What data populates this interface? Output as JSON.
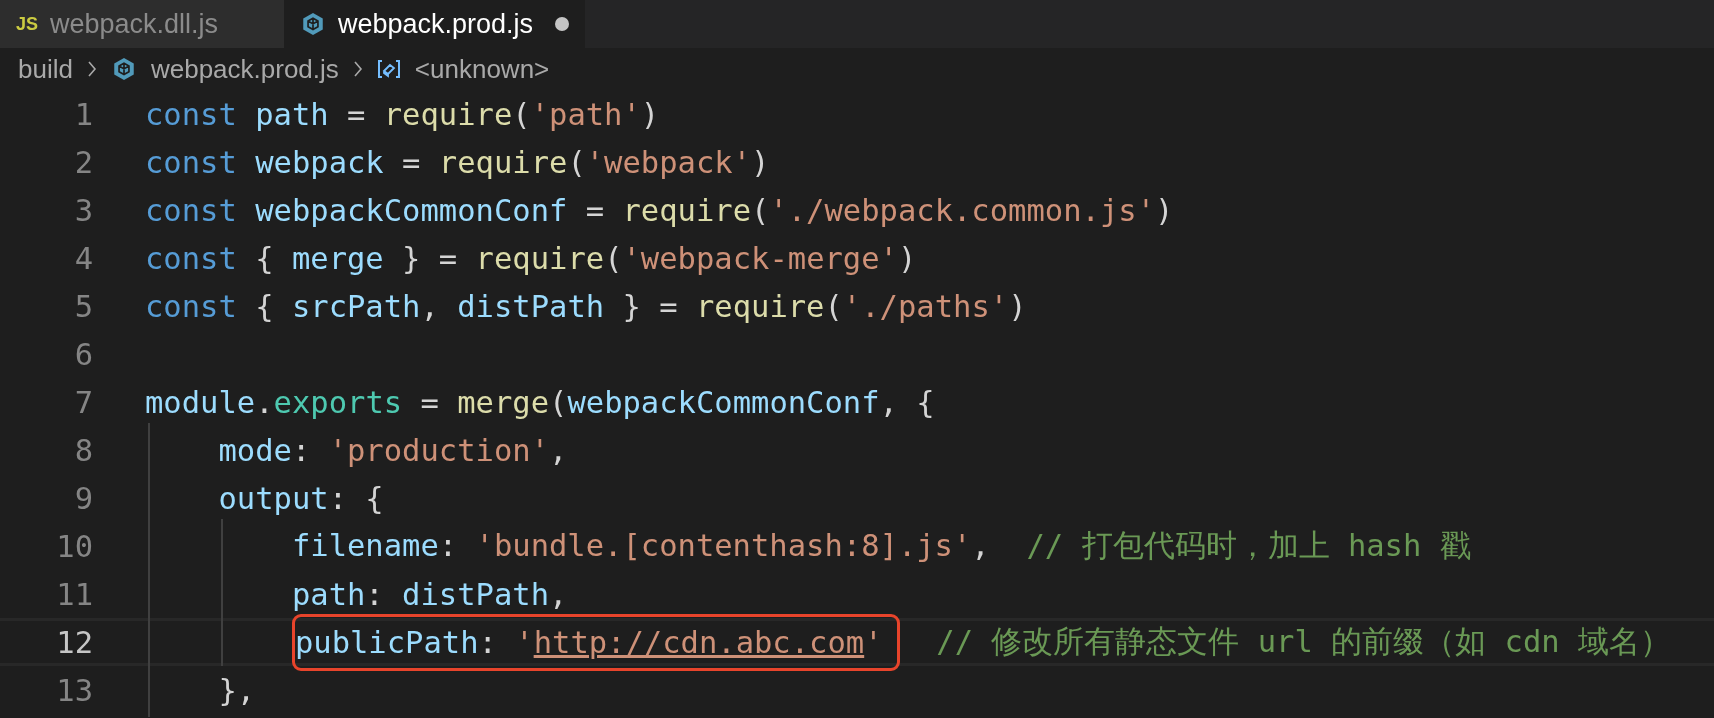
{
  "tabs": [
    {
      "kind": "js",
      "icon_text": "JS",
      "label": "webpack.dll.js",
      "selected": false,
      "modified": false
    },
    {
      "kind": "webpack",
      "label": "webpack.prod.js",
      "selected": true,
      "modified": true
    }
  ],
  "breadcrumb": [
    {
      "kind": "folder",
      "label": "build"
    },
    {
      "kind": "webpack",
      "label": "webpack.prod.js"
    },
    {
      "kind": "symbol",
      "label": "<unknown>"
    }
  ],
  "lines": [
    {
      "number": "1",
      "current": false,
      "segments": [
        {
          "highlighted": false,
          "tokens": [
            {
              "kind": "keyword",
              "text": "const"
            },
            {
              "kind": "variable",
              "text": " path"
            },
            {
              "kind": "plain",
              "text": " = "
            },
            {
              "kind": "function",
              "text": "require"
            },
            {
              "kind": "plain",
              "text": "("
            },
            {
              "kind": "string",
              "text": "'path'"
            },
            {
              "kind": "plain",
              "text": ")"
            }
          ]
        }
      ]
    },
    {
      "number": "2",
      "current": false,
      "segments": [
        {
          "highlighted": false,
          "tokens": [
            {
              "kind": "keyword",
              "text": "const"
            },
            {
              "kind": "variable",
              "text": " webpack"
            },
            {
              "kind": "plain",
              "text": " = "
            },
            {
              "kind": "function",
              "text": "require"
            },
            {
              "kind": "plain",
              "text": "("
            },
            {
              "kind": "string",
              "text": "'webpack'"
            },
            {
              "kind": "plain",
              "text": ")"
            }
          ]
        }
      ]
    },
    {
      "number": "3",
      "current": false,
      "segments": [
        {
          "highlighted": false,
          "tokens": [
            {
              "kind": "keyword",
              "text": "const"
            },
            {
              "kind": "variable",
              "text": " webpackCommonConf"
            },
            {
              "kind": "plain",
              "text": " = "
            },
            {
              "kind": "function",
              "text": "require"
            },
            {
              "kind": "plain",
              "text": "("
            },
            {
              "kind": "string",
              "text": "'./webpack.common.js'"
            },
            {
              "kind": "plain",
              "text": ")"
            }
          ]
        }
      ]
    },
    {
      "number": "4",
      "current": false,
      "segments": [
        {
          "highlighted": false,
          "tokens": [
            {
              "kind": "keyword",
              "text": "const"
            },
            {
              "kind": "plain",
              "text": " { "
            },
            {
              "kind": "variable",
              "text": "merge"
            },
            {
              "kind": "plain",
              "text": " } = "
            },
            {
              "kind": "function",
              "text": "require"
            },
            {
              "kind": "plain",
              "text": "("
            },
            {
              "kind": "string",
              "text": "'webpack-merge'"
            },
            {
              "kind": "plain",
              "text": ")"
            }
          ]
        }
      ]
    },
    {
      "number": "5",
      "current": false,
      "segments": [
        {
          "highlighted": false,
          "tokens": [
            {
              "kind": "keyword",
              "text": "const"
            },
            {
              "kind": "plain",
              "text": " { "
            },
            {
              "kind": "variable",
              "text": "srcPath"
            },
            {
              "kind": "plain",
              "text": ", "
            },
            {
              "kind": "variable",
              "text": "distPath"
            },
            {
              "kind": "plain",
              "text": " } = "
            },
            {
              "kind": "function",
              "text": "require"
            },
            {
              "kind": "plain",
              "text": "("
            },
            {
              "kind": "string",
              "text": "'./paths'"
            },
            {
              "kind": "plain",
              "text": ")"
            }
          ]
        }
      ]
    },
    {
      "number": "6",
      "current": false
    },
    {
      "number": "7",
      "current": false,
      "segments": [
        {
          "highlighted": false,
          "tokens": [
            {
              "kind": "variable",
              "text": "module"
            },
            {
              "kind": "plain",
              "text": "."
            },
            {
              "kind": "type",
              "text": "exports"
            },
            {
              "kind": "plain",
              "text": " = "
            },
            {
              "kind": "function",
              "text": "merge"
            },
            {
              "kind": "plain",
              "text": "("
            },
            {
              "kind": "variable",
              "text": "webpackCommonConf"
            },
            {
              "kind": "plain",
              "text": ", {"
            }
          ]
        }
      ]
    },
    {
      "number": "8",
      "current": false,
      "segments": [
        {
          "highlighted": false,
          "tokens": [
            {
              "kind": "variable",
              "text": "    mode"
            },
            {
              "kind": "plain",
              "text": ": "
            },
            {
              "kind": "string",
              "text": "'production'"
            },
            {
              "kind": "plain",
              "text": ","
            }
          ]
        }
      ]
    },
    {
      "number": "9",
      "current": false,
      "segments": [
        {
          "highlighted": false,
          "tokens": [
            {
              "kind": "variable",
              "text": "    output"
            },
            {
              "kind": "plain",
              "text": ": {"
            }
          ]
        }
      ]
    },
    {
      "number": "10",
      "current": false,
      "segments": [
        {
          "highlighted": false,
          "tokens": [
            {
              "kind": "variable",
              "text": "        filename"
            },
            {
              "kind": "plain",
              "text": ": "
            },
            {
              "kind": "string",
              "text": "'bundle.[contenthash:8].js'"
            },
            {
              "kind": "plain",
              "text": ","
            },
            {
              "kind": "comment",
              "text": "  // 打包代码时，加上 hash 戳"
            }
          ]
        }
      ]
    },
    {
      "number": "11",
      "current": false,
      "segments": [
        {
          "highlighted": false,
          "tokens": [
            {
              "kind": "variable",
              "text": "        path"
            },
            {
              "kind": "plain",
              "text": ": "
            },
            {
              "kind": "variable",
              "text": "distPath"
            },
            {
              "kind": "plain",
              "text": ","
            }
          ]
        }
      ]
    },
    {
      "number": "12",
      "current": true,
      "segments": [
        {
          "highlighted": true,
          "tokens": [
            {
              "kind": "variable",
              "text": "        publicPath"
            },
            {
              "kind": "plain",
              "text": ": "
            },
            {
              "kind": "string",
              "text": "'"
            },
            {
              "kind": "link",
              "text": "http://cdn.abc.com"
            },
            {
              "kind": "string",
              "text": "'"
            }
          ]
        },
        {
          "highlighted": false,
          "tokens": [
            {
              "kind": "comment",
              "text": "  // 修改所有静态文件 url 的前缀（如 cdn 域名）"
            }
          ]
        }
      ]
    },
    {
      "number": "13",
      "current": false,
      "segments": [
        {
          "highlighted": false,
          "tokens": [
            {
              "kind": "plain",
              "text": "    },"
            }
          ]
        }
      ]
    }
  ]
}
